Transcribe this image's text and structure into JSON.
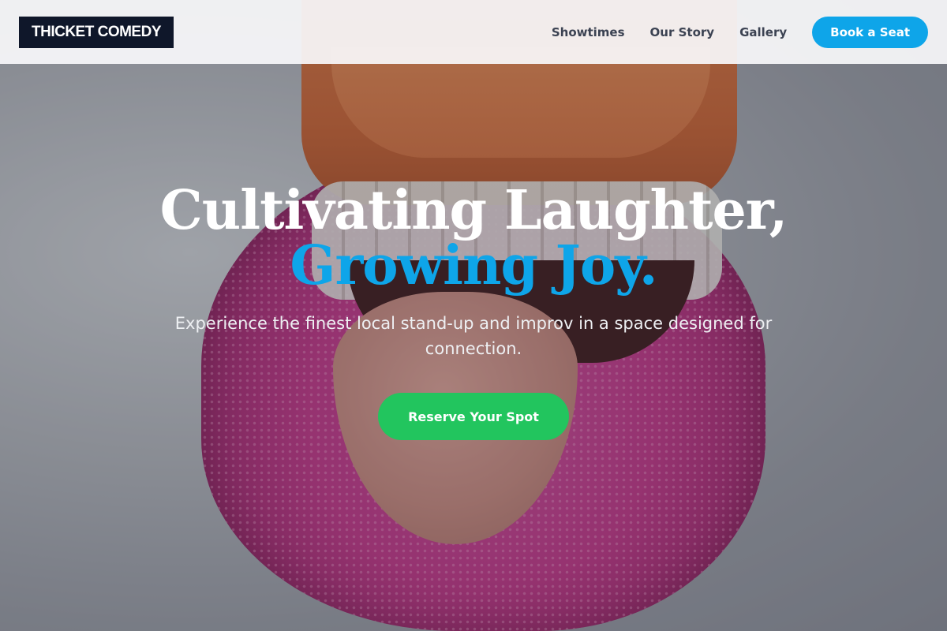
{
  "header": {
    "brand": "THICKET COMEDY",
    "nav": [
      {
        "label": "Showtimes"
      },
      {
        "label": "Our Story"
      },
      {
        "label": "Gallery"
      }
    ],
    "book_label": "Book a Seat"
  },
  "hero": {
    "title_line1": "Cultivating Laughter,",
    "title_line2": "Growing Joy.",
    "subtitle": "Experience the finest local stand-up and improv in a space designed for connection.",
    "cta_label": "Reserve Your Spot"
  },
  "colors": {
    "brand_dark": "#0f172a",
    "accent_blue": "#0ea5e9",
    "cta_green": "#22c55e"
  }
}
